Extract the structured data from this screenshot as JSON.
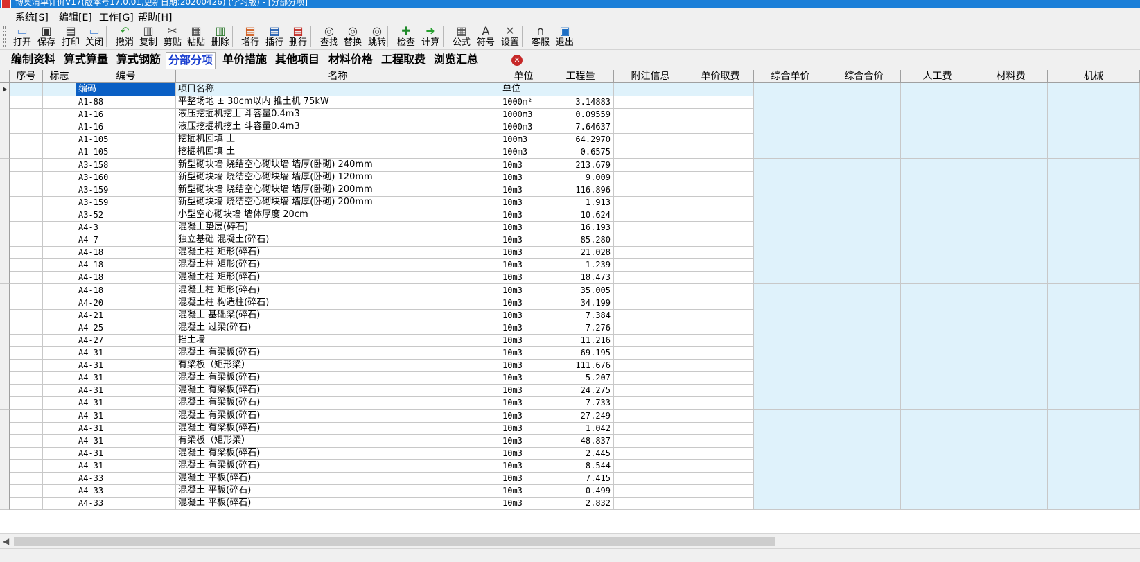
{
  "title": "博奥清单计价V17(版本号17.0.01,更新日期:20200426) (学习版) - [分部分项]",
  "menu": [
    "系统[S]",
    "编辑[E]",
    "工作[G]",
    "帮助[H]"
  ],
  "toolbar": [
    {
      "label": "打开",
      "icon": "folder-open-icon"
    },
    {
      "label": "保存",
      "icon": "save-icon"
    },
    {
      "label": "打印",
      "icon": "print-icon"
    },
    {
      "label": "关闭",
      "icon": "folder-close-icon"
    },
    {
      "label": "撤消",
      "icon": "undo-icon"
    },
    {
      "label": "复制",
      "icon": "copy-icon"
    },
    {
      "label": "剪贴",
      "icon": "scissors-icon"
    },
    {
      "label": "粘贴",
      "icon": "paste-icon"
    },
    {
      "label": "删除",
      "icon": "trash-icon"
    },
    {
      "label": "增行",
      "icon": "add-row-icon"
    },
    {
      "label": "插行",
      "icon": "insert-row-icon"
    },
    {
      "label": "删行",
      "icon": "delete-row-icon"
    },
    {
      "label": "查找",
      "icon": "binoculars-icon"
    },
    {
      "label": "替换",
      "icon": "replace-icon"
    },
    {
      "label": "跳转",
      "icon": "jump-icon"
    },
    {
      "label": "检查",
      "icon": "check-icon"
    },
    {
      "label": "计算",
      "icon": "calculate-icon"
    },
    {
      "label": "公式",
      "icon": "formula-icon"
    },
    {
      "label": "符号",
      "icon": "symbol-icon"
    },
    {
      "label": "设置",
      "icon": "settings-icon"
    },
    {
      "label": "客服",
      "icon": "headset-icon"
    },
    {
      "label": "退出",
      "icon": "exit-icon"
    }
  ],
  "tabs": [
    "编制资料",
    "算式算量",
    "算式钢筋",
    "分部分项",
    "单价措施",
    "其他项目",
    "材料价格",
    "工程取费",
    "浏览汇总"
  ],
  "active_tab": "分部分项",
  "columns": [
    "序号",
    "标志",
    "编号",
    "名称",
    "单位",
    "工程量",
    "附注信息",
    "单价取费",
    "综合单价",
    "综合合价",
    "人工费",
    "材料费",
    "机械"
  ],
  "header_row": {
    "code": "编码",
    "name": "项目名称",
    "unit": "单位"
  },
  "rows": [
    {
      "code": "A1-88",
      "name": "平整场地 ± 30cm以内 推土机 75kW",
      "unit": "1000m²",
      "qty": "3.14883"
    },
    {
      "code": "A1-16",
      "name": "液压挖掘机挖土 斗容量0.4m3",
      "unit": "1000m3",
      "qty": "0.09559"
    },
    {
      "code": "A1-16",
      "name": "液压挖掘机挖土 斗容量0.4m3",
      "unit": "1000m3",
      "qty": "7.64637"
    },
    {
      "code": "A1-105",
      "name": "挖掘机回填 土",
      "unit": "100m3",
      "qty": "64.2970"
    },
    {
      "code": "A1-105",
      "name": "挖掘机回填 土",
      "unit": "100m3",
      "qty": "0.6575"
    },
    {
      "code": "A3-158",
      "name": "新型砌块墙 烧结空心砌块墙 墙厚(卧砌) 240mm",
      "unit": "10m3",
      "qty": "213.679"
    },
    {
      "code": "A3-160",
      "name": "新型砌块墙 烧结空心砌块墙 墙厚(卧砌) 120mm",
      "unit": "10m3",
      "qty": "9.009"
    },
    {
      "code": "A3-159",
      "name": "新型砌块墙 烧结空心砌块墙 墙厚(卧砌) 200mm",
      "unit": "10m3",
      "qty": "116.896"
    },
    {
      "code": "A3-159",
      "name": "新型砌块墙 烧结空心砌块墙 墙厚(卧砌) 200mm",
      "unit": "10m3",
      "qty": "1.913"
    },
    {
      "code": "A3-52",
      "name": "小型空心砌块墙 墙体厚度 20cm",
      "unit": "10m3",
      "qty": "10.624"
    },
    {
      "code": "A4-3",
      "name": "混凝土垫层(碎石)",
      "unit": "10m3",
      "qty": "16.193"
    },
    {
      "code": "A4-7",
      "name": "独立基础 混凝土(碎石)",
      "unit": "10m3",
      "qty": "85.280"
    },
    {
      "code": "A4-18",
      "name": "混凝土柱 矩形(碎石)",
      "unit": "10m3",
      "qty": "21.028"
    },
    {
      "code": "A4-18",
      "name": "混凝土柱 矩形(碎石)",
      "unit": "10m3",
      "qty": "1.239"
    },
    {
      "code": "A4-18",
      "name": "混凝土柱 矩形(碎石)",
      "unit": "10m3",
      "qty": "18.473"
    },
    {
      "code": "A4-18",
      "name": "混凝土柱 矩形(碎石)",
      "unit": "10m3",
      "qty": "35.005"
    },
    {
      "code": "A4-20",
      "name": "混凝土柱 构造柱(碎石)",
      "unit": "10m3",
      "qty": "34.199"
    },
    {
      "code": "A4-21",
      "name": "混凝土 基础梁(碎石)",
      "unit": "10m3",
      "qty": "7.384"
    },
    {
      "code": "A4-25",
      "name": "混凝土 过梁(碎石)",
      "unit": "10m3",
      "qty": "7.276"
    },
    {
      "code": "A4-27",
      "name": "挡土墙",
      "unit": "10m3",
      "qty": "11.216"
    },
    {
      "code": "A4-31",
      "name": "混凝土 有梁板(碎石)",
      "unit": "10m3",
      "qty": "69.195"
    },
    {
      "code": "A4-31",
      "name": "有梁板（矩形梁）",
      "unit": "10m3",
      "qty": "111.676"
    },
    {
      "code": "A4-31",
      "name": "混凝土 有梁板(碎石)",
      "unit": "10m3",
      "qty": "5.207"
    },
    {
      "code": "A4-31",
      "name": "混凝土 有梁板(碎石)",
      "unit": "10m3",
      "qty": "24.275"
    },
    {
      "code": "A4-31",
      "name": "混凝土 有梁板(碎石)",
      "unit": "10m3",
      "qty": "7.733"
    },
    {
      "code": "A4-31",
      "name": "混凝土 有梁板(碎石)",
      "unit": "10m3",
      "qty": "27.249"
    },
    {
      "code": "A4-31",
      "name": "混凝土 有梁板(碎石)",
      "unit": "10m3",
      "qty": "1.042"
    },
    {
      "code": "A4-31",
      "name": "有梁板（矩形梁）",
      "unit": "10m3",
      "qty": "48.837"
    },
    {
      "code": "A4-31",
      "name": "混凝土 有梁板(碎石)",
      "unit": "10m3",
      "qty": "2.445"
    },
    {
      "code": "A4-31",
      "name": "混凝土 有梁板(碎石)",
      "unit": "10m3",
      "qty": "8.544"
    },
    {
      "code": "A4-33",
      "name": "混凝土 平板(碎石)",
      "unit": "10m3",
      "qty": "7.415"
    },
    {
      "code": "A4-33",
      "name": "混凝土 平板(碎石)",
      "unit": "10m3",
      "qty": "0.499"
    },
    {
      "code": "A4-33",
      "name": "混凝土 平板(碎石)",
      "unit": "10m3",
      "qty": "2.832"
    }
  ],
  "colors": {
    "titlebar": "#1b7fd8",
    "active_tab": "#1a3fd0",
    "calc_cell": "#dff2fb",
    "selection": "#0a5fc4"
  }
}
